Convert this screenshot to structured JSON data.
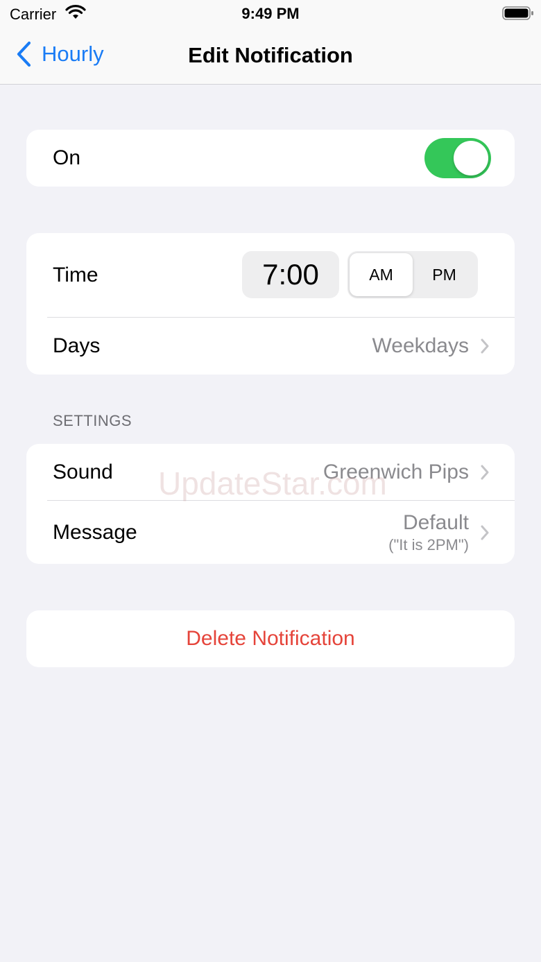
{
  "status_bar": {
    "carrier": "Carrier",
    "time": "9:49 PM",
    "icons": [
      "wifi-icon",
      "battery-icon"
    ]
  },
  "nav": {
    "back_label": "Hourly",
    "back_icon": "chevron-left-icon",
    "title": "Edit Notification"
  },
  "enabled": {
    "label": "On",
    "is_on": true
  },
  "schedule": {
    "time_label": "Time",
    "time_value": "7:00",
    "am_label": "AM",
    "pm_label": "PM",
    "selected_period": "AM",
    "days_label": "Days",
    "days_value": "Weekdays"
  },
  "settings": {
    "header": "SETTINGS",
    "sound_label": "Sound",
    "sound_value": "Greenwich Pips",
    "message_label": "Message",
    "message_value": "Default",
    "message_subvalue": "(\"It is 2PM\")"
  },
  "delete_label": "Delete Notification",
  "watermark": "UpdateStar.com",
  "colors": {
    "accent": "#1a7cf5",
    "toggle_on": "#34c759",
    "destructive": "#e5443a",
    "secondary_text": "#8a8a8e",
    "background": "#f2f2f7"
  }
}
